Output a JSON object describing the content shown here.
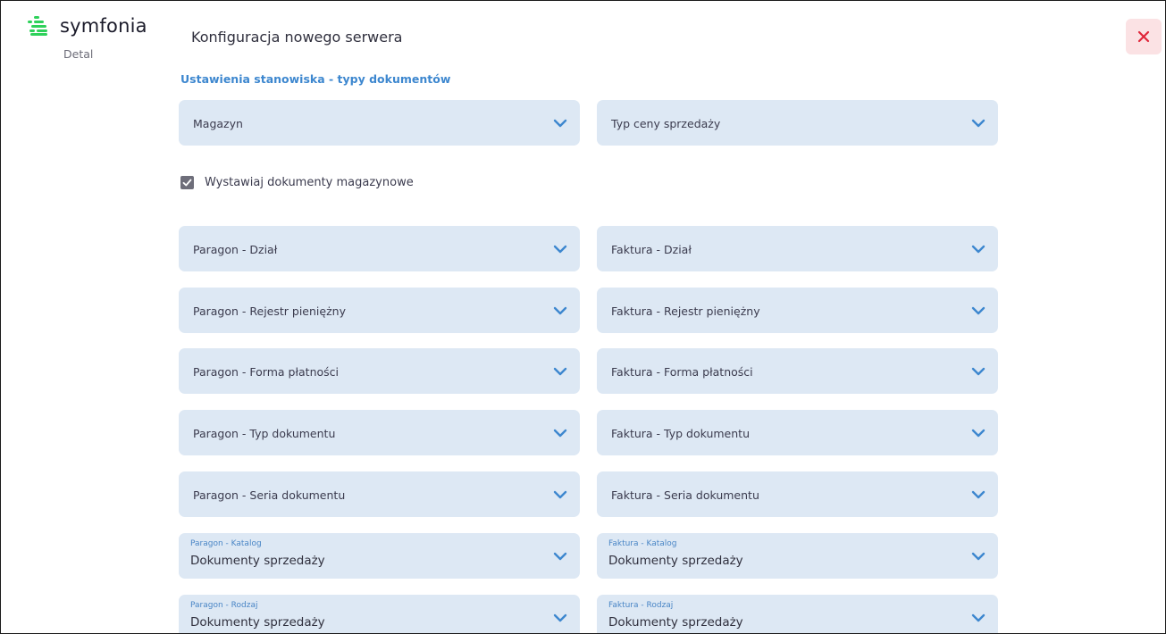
{
  "app": {
    "brand": "symfonia",
    "brand_sub": "Detal",
    "page_title": "Konfiguracja nowego serwera"
  },
  "section": {
    "title": "Ustawienia stanowiska - typy dokumentów"
  },
  "top_selects": {
    "magazyn": "Magazyn",
    "typ_ceny": "Typ ceny sprzedaży"
  },
  "checkbox": {
    "label": "Wystawiaj dokumenty magazynowe",
    "checked": true
  },
  "paragon": {
    "dzial": "Paragon - Dział",
    "rejestr": "Paragon - Rejestr pieniężny",
    "forma": "Paragon - Forma płatności",
    "typ": "Paragon - Typ dokumentu",
    "seria": "Paragon - Seria dokumentu",
    "katalog_label": "Paragon - Katalog",
    "katalog_value": "Dokumenty sprzedaży",
    "rodzaj_label": "Paragon - Rodzaj",
    "rodzaj_value": "Dokumenty sprzedaży"
  },
  "faktura": {
    "dzial": "Faktura - Dział",
    "rejestr": "Faktura - Rejestr pieniężny",
    "forma": "Faktura - Forma płatności",
    "typ": "Faktura - Typ dokumentu",
    "seria": "Faktura - Seria dokumentu",
    "katalog_label": "Faktura - Katalog",
    "katalog_value": "Dokumenty sprzedaży",
    "rodzaj_label": "Faktura - Rodzaj",
    "rodzaj_value": "Dokumenty sprzedaży"
  },
  "colors": {
    "accent": "#3d87cf",
    "select_bg": "#dde8f4",
    "close_bg": "#fbe2e4",
    "close_icon": "#e0263a",
    "logo_green": "#2ed15a"
  },
  "icons": {
    "close": "close-icon",
    "chevron": "chevron-down-icon",
    "check": "check-icon",
    "logo": "symfonia-logo-icon"
  }
}
